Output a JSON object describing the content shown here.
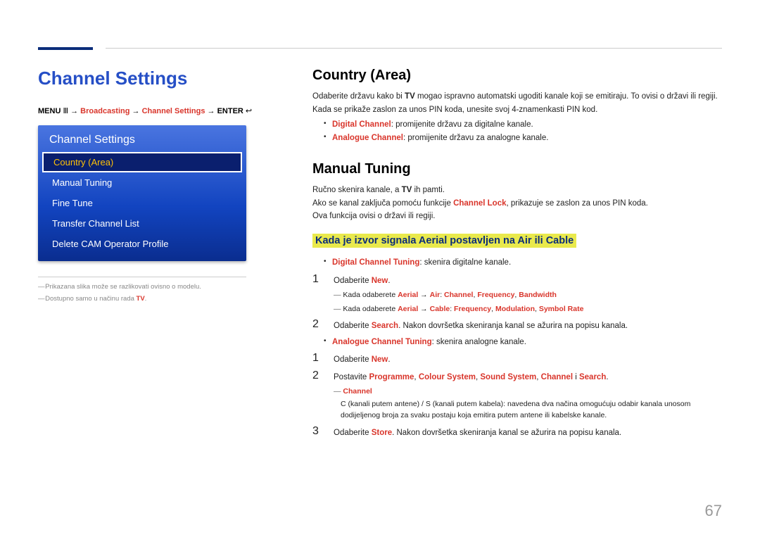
{
  "left": {
    "h1": "Channel Settings",
    "breadcrumb_menu": "MENU",
    "breadcrumb_glyph1": "Ⅲ",
    "breadcrumb_arrow": " → ",
    "breadcrumb_bcast": "Broadcasting",
    "breadcrumb_cs": "Channel Settings",
    "breadcrumb_enter": "ENTER",
    "breadcrumb_glyph2": "↩",
    "menu_title": "Channel Settings",
    "menu_items": [
      "Country (Area)",
      "Manual Tuning",
      "Fine Tune",
      "Transfer Channel List",
      "Delete CAM Operator Profile"
    ],
    "footnote1": "Prikazana slika može se razlikovati ovisno o modelu.",
    "footnote2_a": "Dostupno samo u načinu rada ",
    "footnote2_b": "TV",
    "footnote2_c": "."
  },
  "right": {
    "h_country": "Country (Area)",
    "country_p1_a": "Odaberite državu kako bi ",
    "country_p1_b": "TV",
    "country_p1_c": " mogao ispravno automatski ugoditi kanale koji se emitiraju. To ovisi o državi ili regiji.",
    "country_p2": "Kada se prikaže zaslon za unos PIN koda, unesite svoj 4-znamenkasti PIN kod.",
    "country_b1_a": "Digital Channel",
    "country_b1_b": ": promijenite državu za digitalne kanale.",
    "country_b2_a": "Analogue Channel",
    "country_b2_b": ": promijenite državu za analogne kanale.",
    "h_manual": "Manual Tuning",
    "manual_p1_a": "Ručno skenira kanale, a ",
    "manual_p1_b": "TV",
    "manual_p1_c": " ih pamti.",
    "manual_p2_a": "Ako se kanal zaključa pomoću funkcije ",
    "manual_p2_b": "Channel Lock",
    "manual_p2_c": ", prikazuje se zaslon za unos PIN koda.",
    "manual_p3": "Ova funkcija ovisi o državi ili regiji.",
    "h3_hl": "Kada je izvor signala Aerial postavljen na Air ili Cable",
    "b_dct_a": "Digital Channel Tuning",
    "b_dct_b": ": skenira digitalne kanale.",
    "n1": "1",
    "s1_a": "Odaberite ",
    "s1_b": "New",
    "s1_c": ".",
    "d1_a": "Kada odaberete ",
    "d1_b": "Aerial",
    "d1_c": " → ",
    "d1_d": "Air",
    "d1_e": ": ",
    "d1_f": "Channel",
    "d1_g": ", ",
    "d1_h": "Frequency",
    "d1_i": ", ",
    "d1_j": "Bandwidth",
    "d2_a": "Kada odaberete ",
    "d2_b": "Aerial",
    "d2_c": " → ",
    "d2_d": "Cable",
    "d2_e": ": ",
    "d2_f": "Frequency",
    "d2_g": ", ",
    "d2_h": "Modulation",
    "d2_i": ", ",
    "d2_j": "Symbol Rate",
    "n2": "2",
    "s2_a": "Odaberite ",
    "s2_b": "Search",
    "s2_c": ". Nakon dovršetka skeniranja kanal se ažurira na popisu kanala.",
    "b_act_a": "Analogue Channel Tuning",
    "b_act_b": ": skenira analogne kanale.",
    "n1b": "1",
    "s1b_a": "Odaberite ",
    "s1b_b": "New",
    "s1b_c": ".",
    "n2b": "2",
    "s2b_a": "Postavite ",
    "s2b_b": "Programme",
    "s2b_c": ", ",
    "s2b_d": "Colour System",
    "s2b_e": ", ",
    "s2b_f": "Sound System",
    "s2b_g": ", ",
    "s2b_h": "Channel",
    "s2b_i": " i ",
    "s2b_j": "Search",
    "s2b_k": ".",
    "d3_label": "Channel",
    "d3_a": "C",
    "d3_b": " (kanali putem antene) / ",
    "d3_c": "S",
    "d3_d": " (kanali putem kabela): navedena dva načina omogućuju odabir kanala unosom dodijeljenog broja za svaku postaju koja emitira putem antene ili kabelske kanale.",
    "n3": "3",
    "s3_a": "Odaberite ",
    "s3_b": "Store",
    "s3_c": ". Nakon dovršetka skeniranja kanal se ažurira na popisu kanala."
  },
  "page_num": "67"
}
